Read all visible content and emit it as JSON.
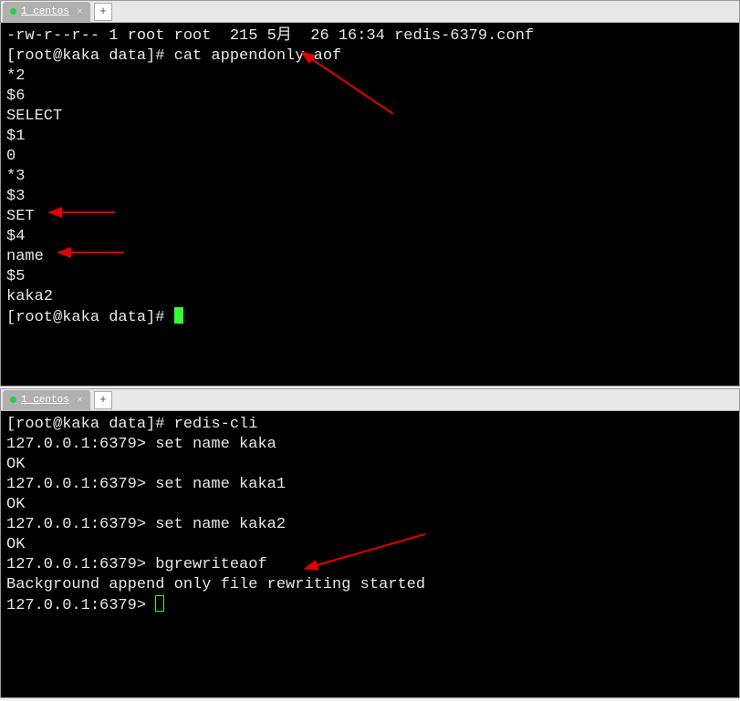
{
  "window1": {
    "tab": {
      "label": "1 centos"
    },
    "lines": [
      "-rw-r--r-- 1 root root  215 5月  26 16:34 redis-6379.conf",
      "[root@kaka data]# cat appendonly.aof",
      "*2",
      "$6",
      "SELECT",
      "$1",
      "0",
      "*3",
      "$3",
      "SET",
      "$4",
      "name",
      "$5",
      "kaka2",
      "[root@kaka data]# "
    ]
  },
  "window2": {
    "tab": {
      "label": "1 centos"
    },
    "lines": [
      "[root@kaka data]# redis-cli",
      "127.0.0.1:6379> set name kaka",
      "OK",
      "127.0.0.1:6379> set name kaka1",
      "OK",
      "127.0.0.1:6379> set name kaka2",
      "OK",
      "127.0.0.1:6379> bgrewriteaof",
      "Background append only file rewriting started",
      "127.0.0.1:6379> "
    ]
  },
  "annotations": {
    "arrow_color": "#e60000"
  }
}
